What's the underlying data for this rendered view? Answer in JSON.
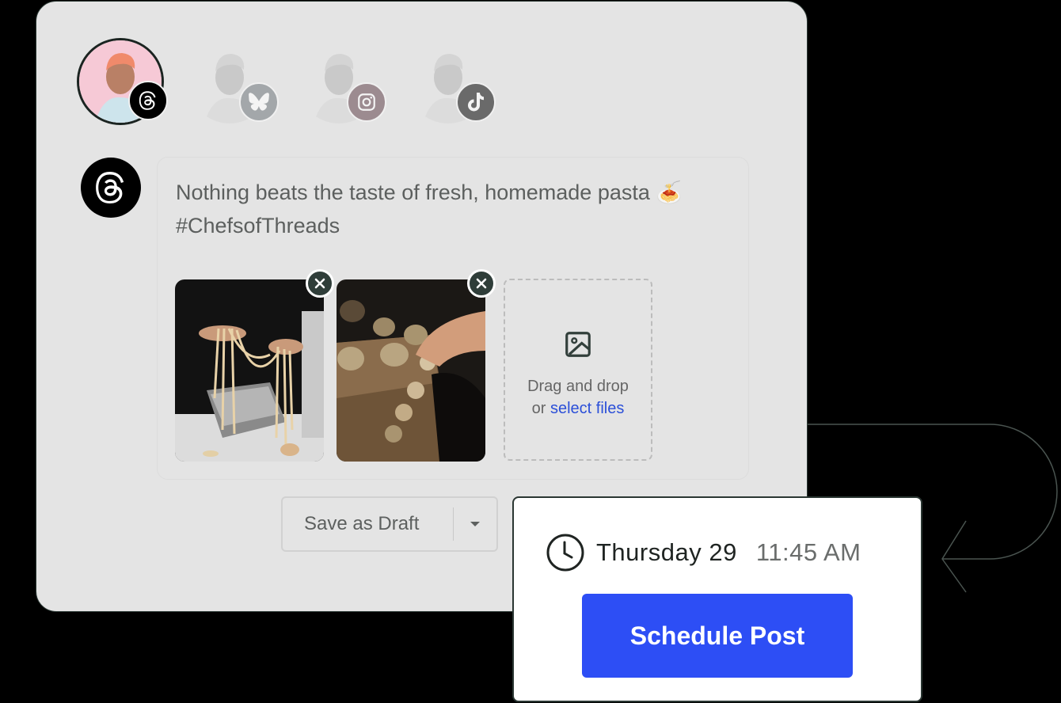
{
  "accounts": [
    {
      "network": "Threads",
      "icon": "threads-icon",
      "selected": true
    },
    {
      "network": "Bluesky",
      "icon": "bluesky-butterfly-icon",
      "selected": false,
      "badge_color": "#a3a7aa"
    },
    {
      "network": "Instagram",
      "icon": "instagram-icon",
      "selected": false,
      "badge_color": "#9c8b90"
    },
    {
      "network": "TikTok",
      "icon": "tiktok-icon",
      "selected": false,
      "badge_color": "#6a6a6a"
    }
  ],
  "composer": {
    "network_icon": "threads-icon",
    "text_line1": "Nothing beats the taste of fresh, homemade pasta 🍝",
    "text_line2": "#ChefsofThreads",
    "media": [
      {
        "alt": "Hands stretching fresh pasta strands over a pasta machine",
        "remove_icon": "close-icon"
      },
      {
        "alt": "Hand shaping ravioli on a floured wooden board",
        "remove_icon": "close-icon"
      }
    ],
    "dropzone": {
      "icon": "image-icon",
      "line1": "Drag and drop",
      "line2_prefix": "or ",
      "line2_link": "select files"
    }
  },
  "actions": {
    "save_draft_label": "Save as Draft",
    "save_draft_menu_icon": "caret-down-icon"
  },
  "schedule": {
    "icon": "clock-icon",
    "day": "Thursday 29",
    "time": "11:45 AM",
    "button_label": "Schedule Post",
    "button_color": "#2d4ef5"
  }
}
